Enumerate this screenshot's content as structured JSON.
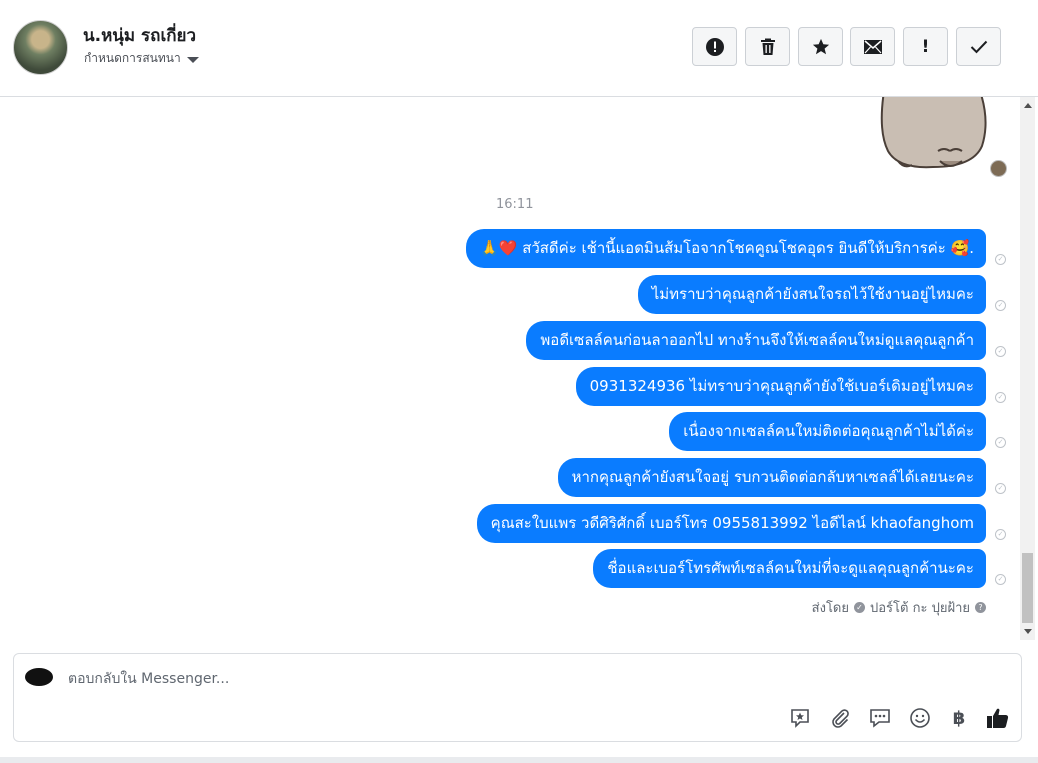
{
  "header": {
    "contact_name": "น.หนุ่ม รถเกี่ยว",
    "conversation_settings": "กำหนดการสนทนา",
    "actions": [
      {
        "name": "mark-spam-button",
        "icon": "alert-circle-icon",
        "glyph": "!"
      },
      {
        "name": "delete-button",
        "icon": "trash-icon",
        "glyph": ""
      },
      {
        "name": "star-button",
        "icon": "star-icon",
        "glyph": "★"
      },
      {
        "name": "mark-unread-button",
        "icon": "envelope-icon",
        "glyph": ""
      },
      {
        "name": "follow-up-button",
        "icon": "exclamation-icon",
        "glyph": "!"
      },
      {
        "name": "mark-done-button",
        "icon": "check-icon",
        "glyph": "✓"
      }
    ]
  },
  "thread": {
    "timestamp": "16:11",
    "messages": [
      "🙏❤️ สวัสดีค่ะ เช้านี้แอดมินส้มโอจากโชคคูณโชคอุดร ยินดีให้บริการค่ะ 🥰.",
      "ไม่ทราบว่าคุณลูกค้ายังสนใจรถไว้ใช้งานอยู่ไหมคะ",
      "พอดีเซลล์คนก่อนลาออกไป ทางร้านจึงให้เซลล์คนใหม่ดูแลคุณลูกค้า",
      "0931324936  ไม่ทราบว่าคุณลูกค้ายังใช้เบอร์เดิมอยู่ไหมคะ",
      "เนื่องจากเซลล์คนใหม่ติดต่อคุณลูกค้าไม่ได้ค่ะ",
      "หากคุณลูกค้ายังสนใจอยู่ รบกวนติดต่อกลับหาเซลล์ได้เลยนะคะ",
      "คุณสะใบแพร วดีศิริศักดิ์ เบอร์โทร 0955813992  ไอดีไลน์  khaofanghom",
      "ชื่อและเบอร์โทรศัพท์เซลล์คนใหม่ที่จะดูแลคุณลูกค้านะคะ"
    ],
    "sent_by_label": "ส่งโดย",
    "sent_by_name": "ปอร์โต้ กะ ปุยฝ้าย",
    "help_glyph": "?"
  },
  "composer": {
    "placeholder": "ตอบกลับใน Messenger...",
    "tools": [
      {
        "name": "saved-reply-icon"
      },
      {
        "name": "attachment-icon"
      },
      {
        "name": "chat-bubble-icon"
      },
      {
        "name": "emoji-icon"
      },
      {
        "name": "baht-payment-icon",
        "glyph": "฿"
      },
      {
        "name": "like-icon"
      }
    ]
  },
  "colors": {
    "bubble": "#0a7cff",
    "border": "#dadde1",
    "muted": "#90949c"
  }
}
